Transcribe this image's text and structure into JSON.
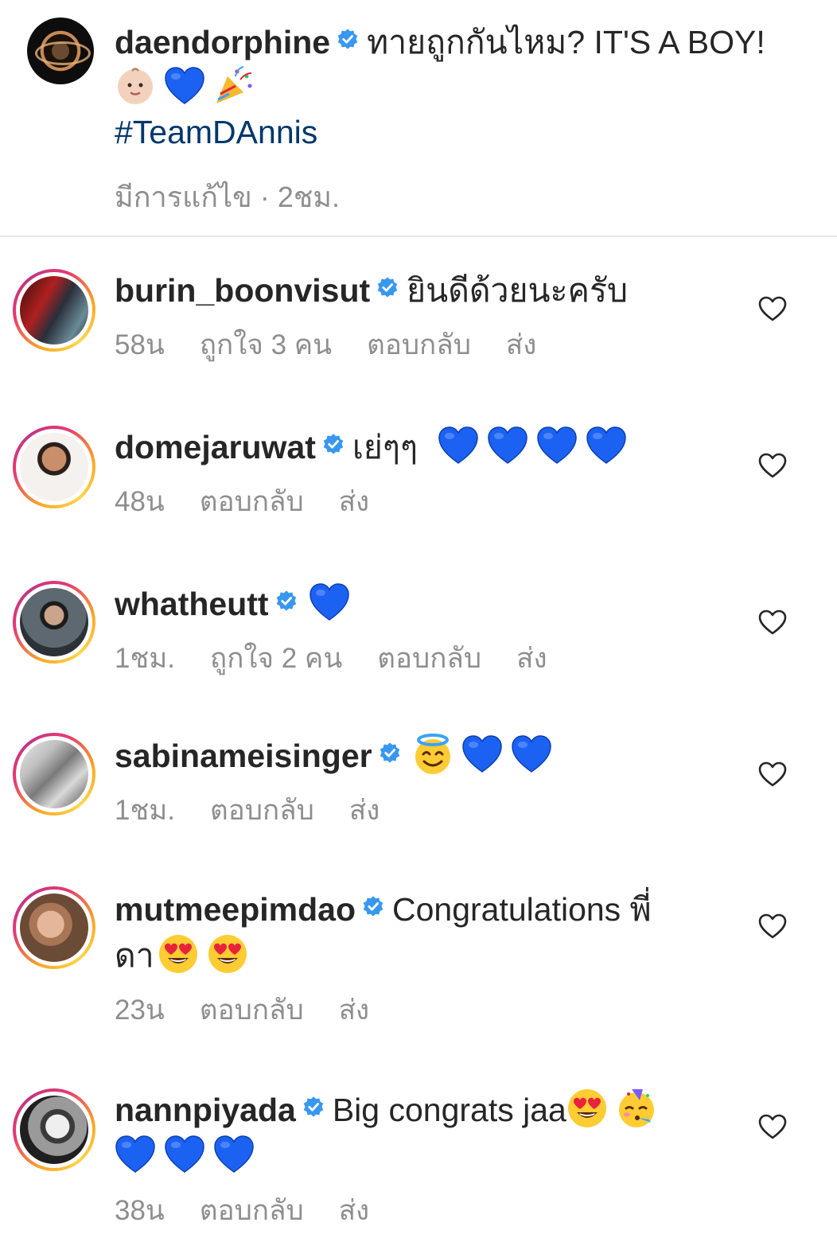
{
  "post": {
    "username": "daendorphine",
    "caption": "ทายถูกกันไหม? IT'S A BOY!",
    "caption_emojis": [
      "👶🏻",
      "💙",
      "🎉"
    ],
    "hashtag": "#TeamDAnnis",
    "edited_label": "มีการแก้ไข",
    "separator": "·",
    "time": "2ชม."
  },
  "comments": [
    {
      "username": "burin_boonvisut",
      "text": "ยินดีด้วยนะครับ",
      "time": "58น",
      "likes": "ถูกใจ 3 คน",
      "reply": "ตอบกลับ",
      "send": "ส่ง"
    },
    {
      "username": "domejaruwat",
      "text": "เย่ๆๆ",
      "time": "48น",
      "reply": "ตอบกลับ",
      "send": "ส่ง"
    },
    {
      "username": "whatheutt",
      "text": "",
      "time": "1ชม.",
      "likes": "ถูกใจ 2 คน",
      "reply": "ตอบกลับ",
      "send": "ส่ง"
    },
    {
      "username": "sabinameisinger",
      "text": "",
      "time": "1ชม.",
      "reply": "ตอบกลับ",
      "send": "ส่ง"
    },
    {
      "username": "mutmeepimdao",
      "text": "Congratulations พี่",
      "text_line2": "ดา",
      "time": "23น",
      "reply": "ตอบกลับ",
      "send": "ส่ง"
    },
    {
      "username": "nannpiyada",
      "text": "Big congrats jaa",
      "time": "38น",
      "reply": "ตอบกลับ",
      "send": "ส่ง"
    }
  ],
  "colors": {
    "verified": "#3897f0",
    "blue_heart": "#1c62f2",
    "hashtag": "#00376b",
    "meta": "#8e8e8e"
  },
  "icons": {
    "like": "heart-outline-icon",
    "verified": "verified-badge-icon"
  }
}
